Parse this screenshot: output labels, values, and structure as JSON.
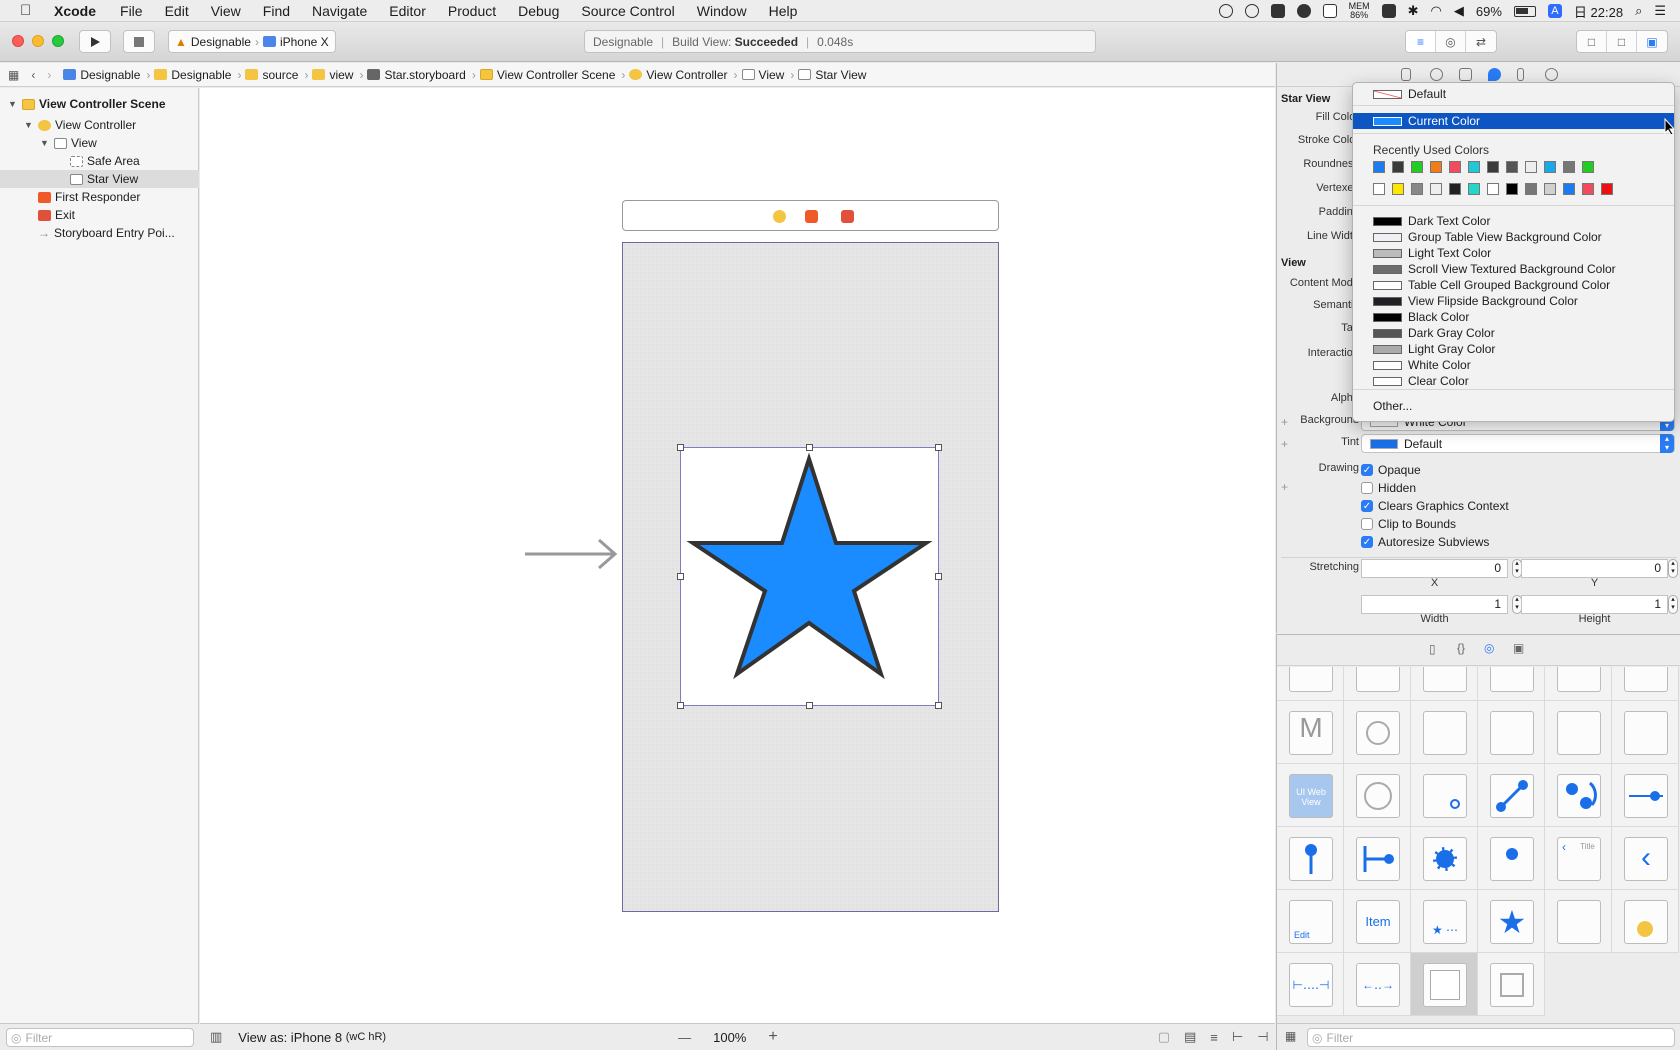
{
  "menubar": {
    "apple": "",
    "app": "Xcode",
    "items": [
      "File",
      "Edit",
      "View",
      "Find",
      "Navigate",
      "Editor",
      "Product",
      "Debug",
      "Source Control",
      "Window",
      "Help"
    ],
    "mem_label": "MEM",
    "mem_value": "86%",
    "battery": "69%",
    "input_source": "A",
    "clock": "日 22:28"
  },
  "toolbar": {
    "scheme": "Designable",
    "device": "iPhone X",
    "activity": {
      "project": "Designable",
      "status_label": "Build View:",
      "status_value": "Succeeded",
      "time": "0.048s"
    }
  },
  "jumpbar": [
    "Designable",
    "Designable",
    "source",
    "view",
    "Star.storyboard",
    "View Controller Scene",
    "View Controller",
    "View",
    "Star View"
  ],
  "navigator": {
    "rows": [
      {
        "label": "View Controller Scene",
        "bold": true
      },
      {
        "label": "View Controller"
      },
      {
        "label": "View"
      },
      {
        "label": "Safe Area"
      },
      {
        "label": "Star View",
        "selected": true
      },
      {
        "label": "First Responder"
      },
      {
        "label": "Exit"
      },
      {
        "label": "Storyboard Entry Poi..."
      }
    ],
    "filter_placeholder": "Filter"
  },
  "canvas": {
    "view_as": "View as: iPhone 8",
    "view_as_size": "(wC hR)",
    "zoom": "100%",
    "zoom_minus": "—",
    "zoom_plus": "+",
    "star_fill": "#1a8cff",
    "star_stroke": "#333333"
  },
  "inspector": {
    "star_section": "Star View",
    "star_labels": [
      "Fill Color",
      "Stroke Color",
      "Roundness",
      "Vertexes",
      "Padding",
      "Line Width"
    ],
    "view_section": "View",
    "view_labels": [
      "Content Mode",
      "Semantic",
      "Tag",
      "Interaction"
    ],
    "alpha_label": "Alpha",
    "background_label": "Background",
    "background_value": "White Color",
    "tint_label": "Tint",
    "tint_value": "Default",
    "drawing_label": "Drawing",
    "drawing_options": [
      {
        "label": "Opaque",
        "checked": true
      },
      {
        "label": "Hidden",
        "checked": false
      },
      {
        "label": "Clears Graphics Context",
        "checked": true
      },
      {
        "label": "Clip to Bounds",
        "checked": false
      },
      {
        "label": "Autoresize Subviews",
        "checked": true
      }
    ],
    "stretching_label": "Stretching",
    "stretch_x": "0",
    "stretch_y": "0",
    "stretch_width": "1",
    "stretch_height": "1",
    "x_label": "X",
    "y_label": "Y",
    "width_label": "Width",
    "height_label": "Height",
    "plus": "+"
  },
  "color_menu": {
    "default_label": "Default",
    "current_label": "Current Color",
    "recent_header": "Recently Used Colors",
    "recent_row1": [
      "#1a7cf0",
      "#3a3a3a",
      "#22cc22",
      "#f07c1a",
      "#f24b5e",
      "#22c8d8",
      "#3a3a3a",
      "#555555",
      "#eeeeee",
      "#1aa8e8",
      "#777777",
      "#22cc22"
    ],
    "recent_row2": [
      "#ffffff",
      "#ffe600",
      "#888888",
      "#eeeeee",
      "#222222",
      "#22d6c8",
      "#ffffff",
      "#000000",
      "#777777",
      "#d0d0d0",
      "#1a7cf0",
      "#f24b5e",
      "#ee1111"
    ],
    "named_colors": [
      {
        "label": "Dark Text Color",
        "swatch": "#000000"
      },
      {
        "label": "Group Table View Background Color",
        "swatch": "#efeff4"
      },
      {
        "label": "Light Text Color",
        "swatch": "#bbbbbb"
      },
      {
        "label": "Scroll View Textured Background Color",
        "swatch": "#6d6d6d"
      },
      {
        "label": "Table Cell Grouped Background Color",
        "swatch": "#ffffff"
      },
      {
        "label": "View Flipside Background Color",
        "swatch": "#1f1f24"
      },
      {
        "label": "Black Color",
        "swatch": "#000000"
      },
      {
        "label": "Dark Gray Color",
        "swatch": "#555555"
      },
      {
        "label": "Light Gray Color",
        "swatch": "#aaaaaa"
      },
      {
        "label": "White Color",
        "swatch": "#ffffff"
      },
      {
        "label": "Clear Color",
        "swatch": "#ffffff"
      }
    ],
    "other_label": "Other..."
  },
  "library": {
    "filter_placeholder": "Filter",
    "item_text": "Item",
    "title_text": "Title",
    "edit_text": "Edit",
    "web_text": "UI Web View"
  }
}
